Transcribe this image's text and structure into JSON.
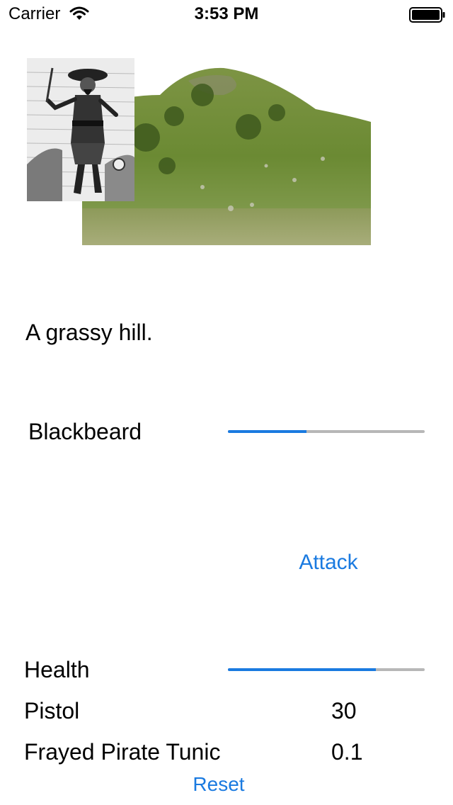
{
  "status_bar": {
    "carrier": "Carrier",
    "time": "3:53 PM",
    "wifi_icon": "wifi-icon",
    "battery_icon": "battery-icon"
  },
  "scene": {
    "image": "grassy-hill-photo",
    "description": "A grassy hill."
  },
  "enemy": {
    "portrait": "blackbeard-engraving",
    "name": "Blackbeard",
    "health_fraction": 0.4
  },
  "actions": {
    "attack_label": "Attack",
    "reset_label": "Reset"
  },
  "player": {
    "health_label": "Health",
    "health_fraction": 0.75,
    "weapon": {
      "name": "Pistol",
      "value": "30"
    },
    "armor": {
      "name": "Frayed Pirate Tunic",
      "value": "0.1"
    }
  },
  "colors": {
    "accent": "#1a7ae0",
    "track": "#b7b7b7"
  }
}
